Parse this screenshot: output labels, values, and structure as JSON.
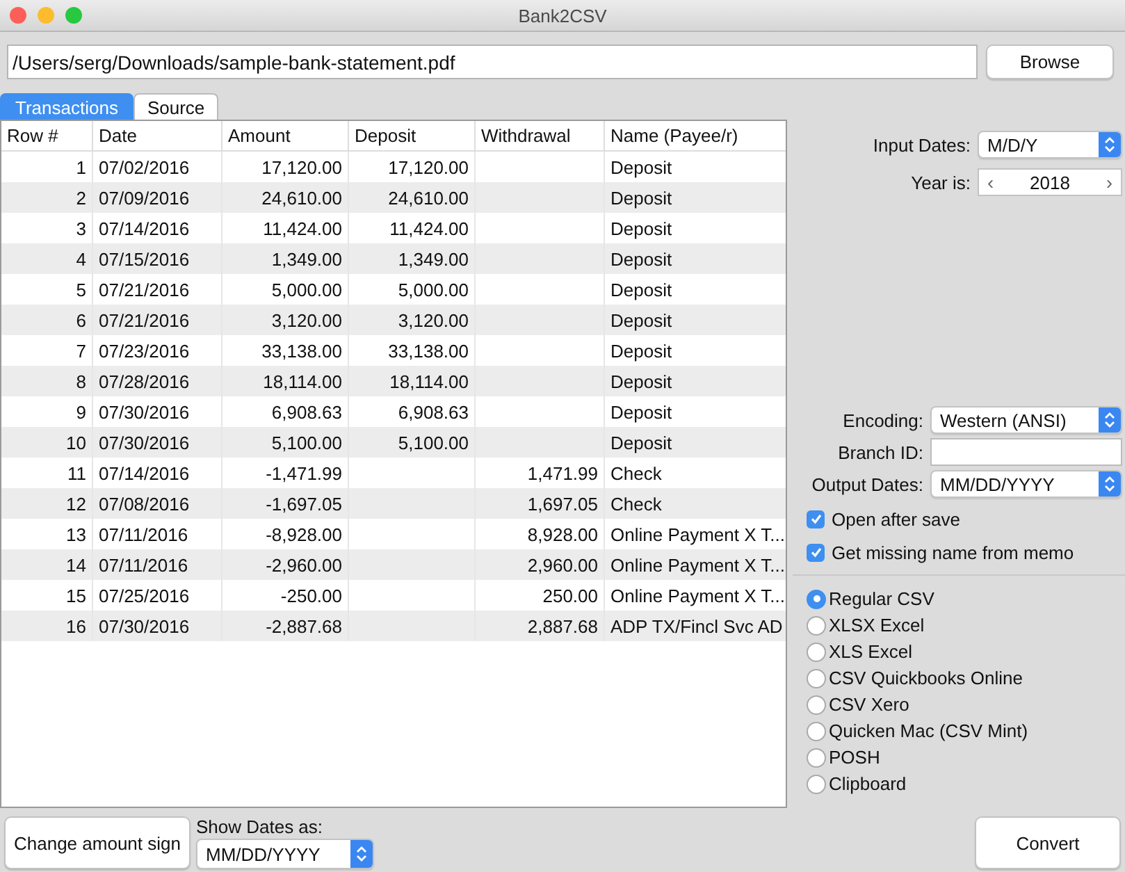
{
  "window": {
    "title": "Bank2CSV"
  },
  "file": {
    "path": "/Users/serg/Downloads/sample-bank-statement.pdf",
    "browse": "Browse"
  },
  "tabs": [
    {
      "label": "Transactions",
      "selected": true
    },
    {
      "label": "Source",
      "selected": false
    }
  ],
  "table": {
    "columns": [
      "Row #",
      "Date",
      "Amount",
      "Deposit",
      "Withdrawal",
      "Name (Payee/r)"
    ],
    "rows": [
      {
        "row": "1",
        "date": "07/02/2016",
        "amount": "17,120.00",
        "deposit": "17,120.00",
        "name": "Deposit"
      },
      {
        "row": "2",
        "date": "07/09/2016",
        "amount": "24,610.00",
        "deposit": "24,610.00",
        "name": "Deposit"
      },
      {
        "row": "3",
        "date": "07/14/2016",
        "amount": "11,424.00",
        "deposit": "11,424.00",
        "name": "Deposit"
      },
      {
        "row": "4",
        "date": "07/15/2016",
        "amount": "1,349.00",
        "deposit": "1,349.00",
        "name": "Deposit"
      },
      {
        "row": "5",
        "date": "07/21/2016",
        "amount": "5,000.00",
        "deposit": "5,000.00",
        "name": "Deposit"
      },
      {
        "row": "6",
        "date": "07/21/2016",
        "amount": "3,120.00",
        "deposit": "3,120.00",
        "name": "Deposit"
      },
      {
        "row": "7",
        "date": "07/23/2016",
        "amount": "33,138.00",
        "deposit": "33,138.00",
        "name": "Deposit"
      },
      {
        "row": "8",
        "date": "07/28/2016",
        "amount": "18,114.00",
        "deposit": "18,114.00",
        "name": "Deposit"
      },
      {
        "row": "9",
        "date": "07/30/2016",
        "amount": "6,908.63",
        "deposit": "6,908.63",
        "name": "Deposit"
      },
      {
        "row": "10",
        "date": "07/30/2016",
        "amount": "5,100.00",
        "deposit": "5,100.00",
        "name": "Deposit"
      },
      {
        "row": "11",
        "date": "07/14/2016",
        "amount": "-1,471.99",
        "withdrawal": "1,471.99",
        "name": "Check"
      },
      {
        "row": "12",
        "date": "07/08/2016",
        "amount": "-1,697.05",
        "withdrawal": "1,697.05",
        "name": "Check"
      },
      {
        "row": "13",
        "date": "07/11/2016",
        "amount": "-8,928.00",
        "withdrawal": "8,928.00",
        "name": "Online Payment X T..."
      },
      {
        "row": "14",
        "date": "07/11/2016",
        "amount": "-2,960.00",
        "withdrawal": "2,960.00",
        "name": "Online Payment X T..."
      },
      {
        "row": "15",
        "date": "07/25/2016",
        "amount": "-250.00",
        "withdrawal": "250.00",
        "name": "Online Payment X T..."
      },
      {
        "row": "16",
        "date": "07/30/2016",
        "amount": "-2,887.68",
        "withdrawal": "2,887.68",
        "name": "ADP TX/Fincl Svc AD"
      }
    ]
  },
  "settings": {
    "input_dates": {
      "label": "Input Dates:",
      "value": "M/D/Y"
    },
    "year": {
      "label": "Year is:",
      "prev": "‹",
      "value": "2018",
      "next": "›"
    },
    "encoding": {
      "label": "Encoding:",
      "value": "Western (ANSI)"
    },
    "branch_id": {
      "label": "Branch ID:"
    },
    "output_dates": {
      "label": "Output Dates:",
      "value": "MM/DD/YYYY"
    },
    "checkboxes": [
      {
        "label": "Open after save",
        "checked": true
      },
      {
        "label": "Get missing name from memo",
        "checked": true
      }
    ],
    "formats": [
      {
        "label": "Regular CSV",
        "selected": true
      },
      {
        "label": "XLSX Excel",
        "selected": false
      },
      {
        "label": "XLS Excel",
        "selected": false
      },
      {
        "label": "CSV Quickbooks Online",
        "selected": false
      },
      {
        "label": "CSV Xero",
        "selected": false
      },
      {
        "label": "Quicken Mac (CSV Mint)",
        "selected": false
      },
      {
        "label": "POSH",
        "selected": false
      },
      {
        "label": "Clipboard",
        "selected": false
      }
    ]
  },
  "bottom": {
    "change_sign": "Change amount sign",
    "show_dates": {
      "label": "Show Dates as:",
      "value": "MM/DD/YYYY"
    },
    "convert": "Convert"
  }
}
